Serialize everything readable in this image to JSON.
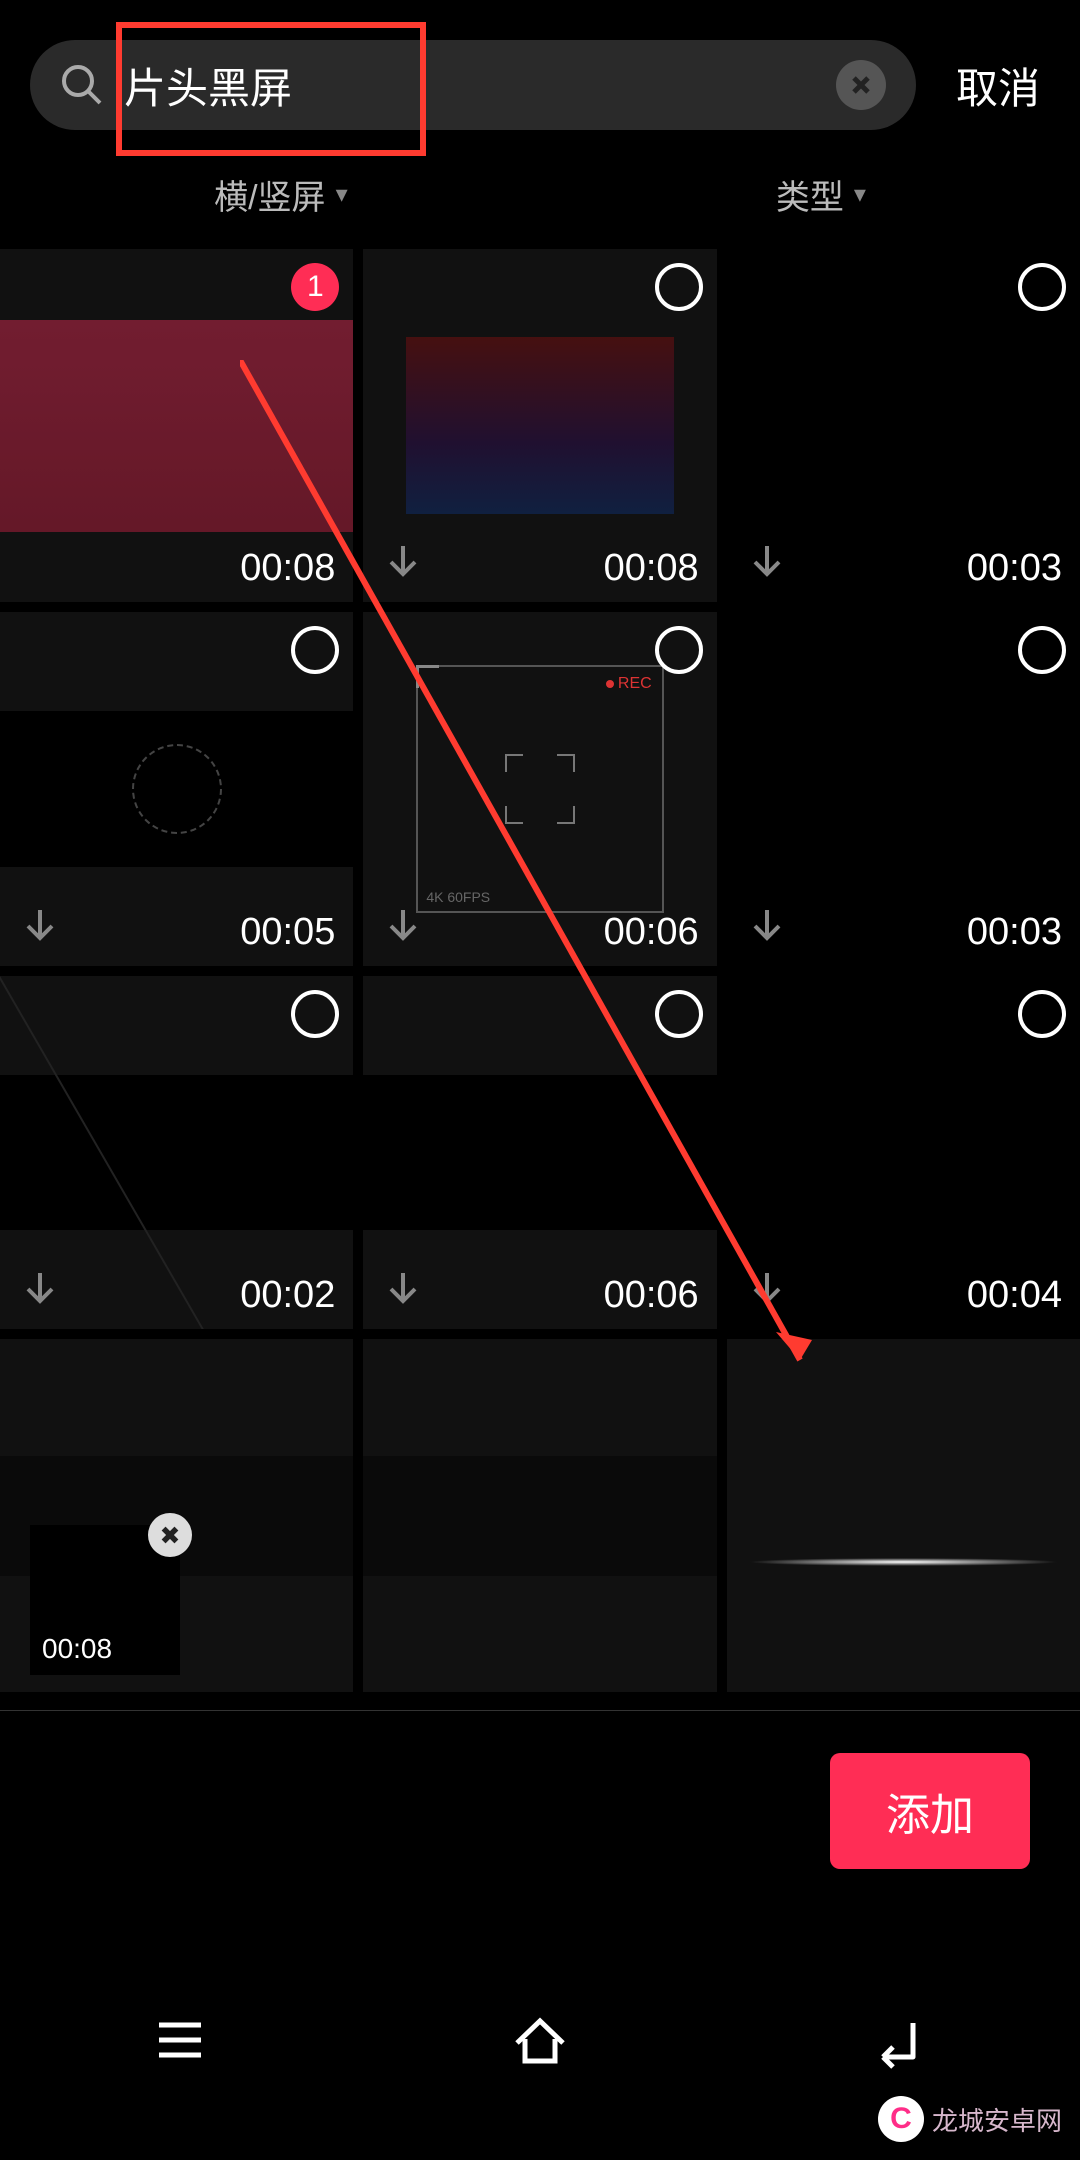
{
  "search": {
    "value": "片头黑屏",
    "placeholder": ""
  },
  "cancel_label": "取消",
  "filters": {
    "orientation": "横/竖屏",
    "type": "类型"
  },
  "grid": [
    {
      "duration": "00:08",
      "selected": true,
      "sel_index": "1",
      "download": false,
      "thumb": "maroon"
    },
    {
      "duration": "00:08",
      "selected": false,
      "download": true,
      "thumb": "grad"
    },
    {
      "duration": "00:03",
      "selected": false,
      "download": true,
      "thumb": "black"
    },
    {
      "duration": "00:05",
      "selected": false,
      "download": true,
      "thumb": "ring"
    },
    {
      "duration": "00:06",
      "selected": false,
      "download": true,
      "thumb": "rec"
    },
    {
      "duration": "00:03",
      "selected": false,
      "download": true,
      "thumb": "black"
    },
    {
      "duration": "00:02",
      "selected": false,
      "download": true,
      "thumb": "diag"
    },
    {
      "duration": "00:06",
      "selected": false,
      "download": true,
      "thumb": "band"
    },
    {
      "duration": "00:04",
      "selected": false,
      "download": true,
      "thumb": "black"
    },
    {
      "duration": "",
      "selected": false,
      "download": false,
      "thumb": "band-light"
    },
    {
      "duration": "",
      "selected": false,
      "download": false,
      "thumb": "band-light"
    },
    {
      "duration": "",
      "selected": false,
      "download": false,
      "thumb": "line"
    }
  ],
  "rec_overlay": {
    "rec": "REC",
    "fps": "4K 60FPS"
  },
  "tray": [
    {
      "duration": "00:08"
    }
  ],
  "add_label": "添加",
  "watermark": {
    "logo": "C",
    "text": "龙城安卓网"
  },
  "colors": {
    "accent": "#ff2d55",
    "annotation": "#ff3b30"
  }
}
